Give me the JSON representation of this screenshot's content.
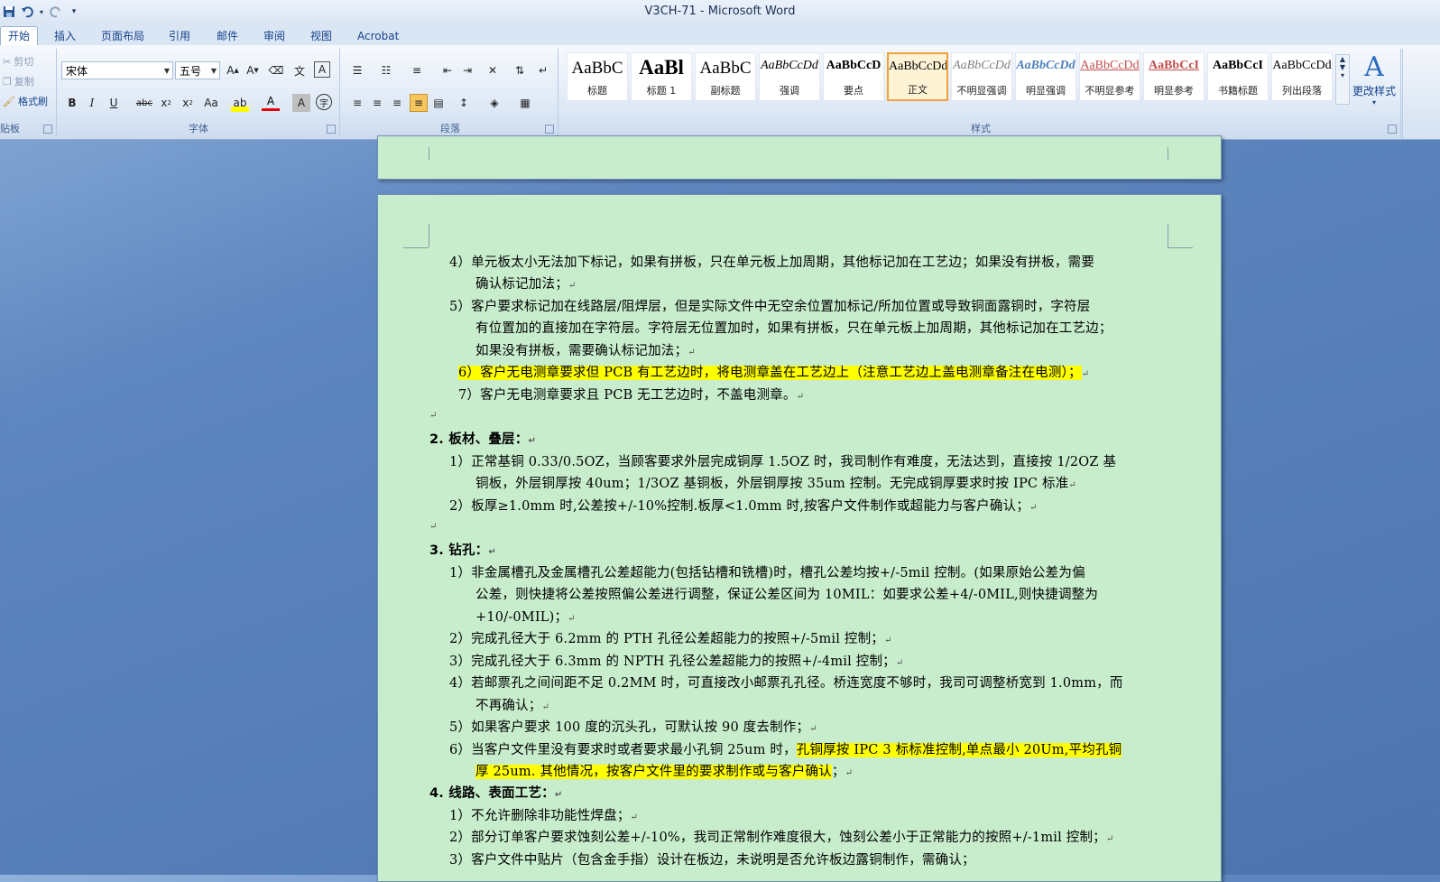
{
  "app": {
    "title": "V3CH-71 - Microsoft Word"
  },
  "quick_access": {
    "save_icon": "save-icon",
    "undo_icon": "undo-icon",
    "redo_icon": "redo-icon",
    "more": "▾"
  },
  "tabs": [
    "开始",
    "插入",
    "页面布局",
    "引用",
    "邮件",
    "审阅",
    "视图",
    "Acrobat"
  ],
  "clipboard": {
    "cut": "剪切",
    "copy": "复制",
    "format_painter": "格式刷",
    "label": "贴板"
  },
  "font": {
    "name": "宋体",
    "size": "五号",
    "label": "字体"
  },
  "paragraph": {
    "label": "段落"
  },
  "styles": {
    "label": "样式",
    "items": [
      {
        "preview": "AaBbC",
        "name": "标题"
      },
      {
        "preview": "AaBl",
        "name": "标题 1"
      },
      {
        "preview": "AaBbC",
        "name": "副标题"
      },
      {
        "preview": "AaBbCcDd",
        "name": "强调"
      },
      {
        "preview": "AaBbCcD",
        "name": "要点"
      },
      {
        "preview": "AaBbCcDd",
        "name": "正文"
      },
      {
        "preview": "AaBbCcDd",
        "name": "不明显强调"
      },
      {
        "preview": "AaBbCcDd",
        "name": "明显强调"
      },
      {
        "preview": "AaBbCcDd",
        "name": "不明显参考"
      },
      {
        "preview": "AaBbCcI",
        "name": "明显参考"
      },
      {
        "preview": "AaBbCcI",
        "name": "书籍标题"
      },
      {
        "preview": "AaBbCcDd",
        "name": "列出段落"
      }
    ],
    "change": "更改样式"
  },
  "doc": {
    "l1": "4）单元板太小无法加下标记，如果有拼板，只在单元板上加周期，其他标记加在工艺边；如果没有拼板，需要",
    "l2": "确认标记加法；",
    "l3": "5）客户要求标记加在线路层/阻焊层，但是实际文件中无空余位置加标记/所加位置或导致铜面露铜时，字符层",
    "l4": "有位置加的直接加在字符层。字符层无位置加时，如果有拼板，只在单元板上加周期，其他标记加在工艺边；",
    "l5": "如果没有拼板，需要确认标记加法；",
    "l6": "6）客户无电测章要求但 PCB 有工艺边时，将电测章盖在工艺边上（注意工艺边上盖电测章备注在电测）；",
    "l7": "7）客户无电测章要求且 PCB 无工艺边时，不盖电测章。",
    "h2": "2.  板材、叠层：",
    "l9": "1）正常基铜 0.33/0.5OZ，当顾客要求外层完成铜厚 1.5OZ 时，我司制作有难度，无法达到，直接按 1/2OZ 基",
    "l10": "铜板，外层铜厚按 40um；1/3OZ 基铜板，外层铜厚按 35um 控制。无完成铜厚要求时按 IPC 标准",
    "l11": "2）板厚≥1.0mm 时,公差按+/-10%控制.板厚<1.0mm 时,按客户文件制作或超能力与客户确认；",
    "h3": "3.  钻孔：",
    "l13": "1）非金属槽孔及金属槽孔公差超能力(包括钻槽和铣槽)时，槽孔公差均按+/-5mil 控制。(如果原始公差为偏",
    "l14": "公差，则快捷将公差按照偏公差进行调整，保证公差区间为 10MIL：如要求公差+4/-0MIL,则快捷调整为",
    "l15": "+10/-0MIL)；",
    "l16": "2）完成孔径大于 6.2mm 的 PTH 孔径公差超能力的按照+/-5mil 控制；",
    "l17": "3）完成孔径大于 6.3mm 的 NPTH 孔径公差超能力的按照+/-4mil 控制；",
    "l18": "4）若邮票孔之间间距不足 0.2MM 时，可直接改小邮票孔孔径。桥连宽度不够时，我司可调整桥宽到 1.0mm，而",
    "l19": "不再确认；",
    "l20": "5）如果客户要求 100 度的沉头孔，可默认按 90 度去制作；",
    "l21a": "6）当客户文件里没有要求时或者要求最小孔铜 25um 时，",
    "l21b": "孔铜厚按 IPC 3 标标准控制,单点最小 20Um,平均孔铜",
    "l22": "厚 25um. 其他情况，按客户文件里的要求制作或与客户确认",
    "l22c": "；",
    "h4": "4.  线路、表面工艺：",
    "l24": "1）不允许删除非功能性焊盘；",
    "l25": "2）部分订单客户要求蚀刻公差+/-10%，我司正常制作难度很大，蚀刻公差小于正常能力的按照+/-1mil 控制；",
    "l26": "3）客户文件中贴片（包含金手指）设计在板边，未说明是否允许板边露铜制作，需确认；",
    "pm": "↵"
  }
}
